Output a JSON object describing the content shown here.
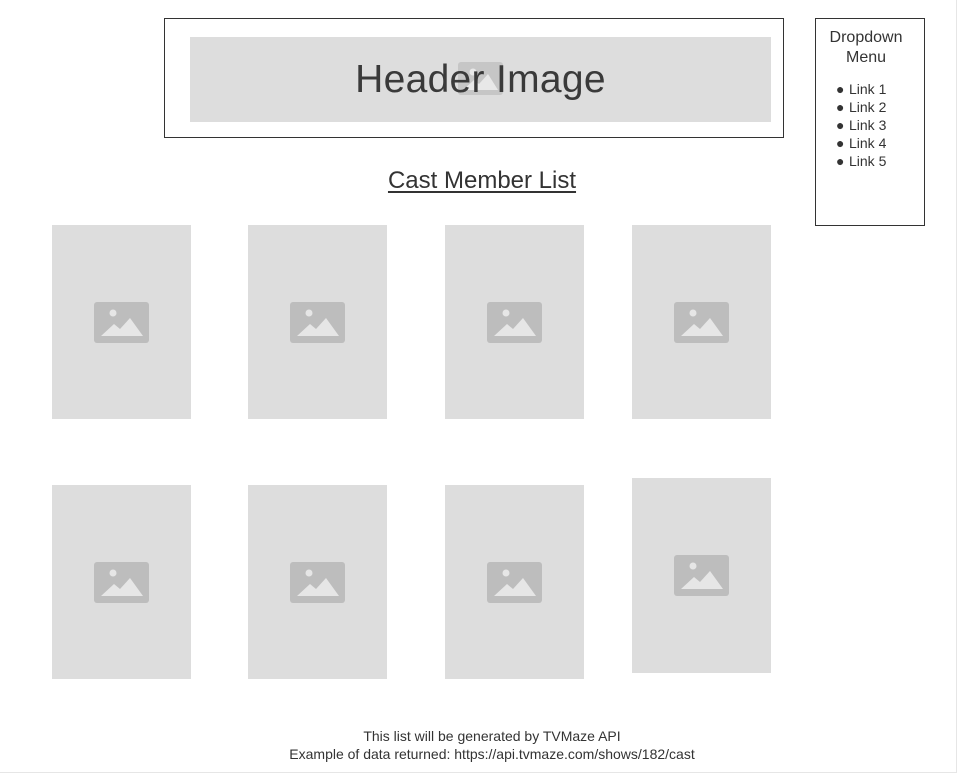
{
  "header": {
    "title": "Header Image",
    "image_icon": "image-placeholder-icon"
  },
  "dropdown": {
    "title_line1": "Dropdown",
    "title_line2": "Menu",
    "links": [
      "Link 1",
      "Link 2",
      "Link 3",
      "Link 4",
      "Link 5"
    ]
  },
  "cast_list": {
    "title": "Cast Member List",
    "card_icon": "image-placeholder-icon",
    "card_count": 8
  },
  "footer": {
    "line1": "This list will be generated by TVMaze API",
    "line2": "Example of data returned:  https://api.tvmaze.com/shows/182/cast"
  },
  "colors": {
    "placeholder": "#dddddd",
    "icon": "#bbbbbb",
    "text": "#333333"
  }
}
